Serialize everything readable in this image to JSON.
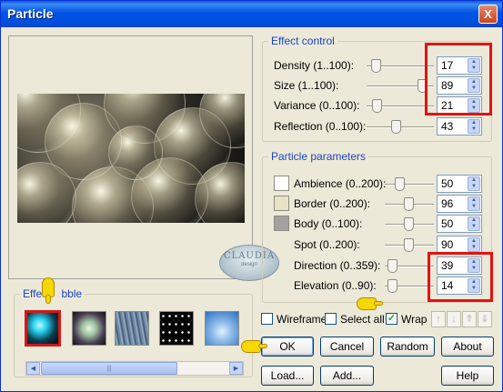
{
  "window": {
    "title": "Particle",
    "close_glyph": "X"
  },
  "logo": {
    "line1": "CLAUDIA",
    "line2": "design"
  },
  "effect_control": {
    "title": "Effect control",
    "rows": [
      {
        "label": "Density (1..100):",
        "value": "17"
      },
      {
        "label": "Size (1..100):",
        "value": "89"
      },
      {
        "label": "Variance (0..100):",
        "value": "21"
      },
      {
        "label": "Reflection (0..100):",
        "value": "43"
      }
    ]
  },
  "particle_params": {
    "title": "Particle parameters",
    "rows": [
      {
        "label": "Ambience (0..200):",
        "value": "50",
        "swatch": "#ffffff"
      },
      {
        "label": "Border (0..200):",
        "value": "96",
        "swatch": "#e7e3c4"
      },
      {
        "label": "Body (0..100):",
        "value": "50",
        "swatch": "#a3a29f"
      },
      {
        "label": "Spot (0..200):",
        "value": "90"
      },
      {
        "label": "Direction (0..359):",
        "value": "39"
      },
      {
        "label": "Elevation (0..90):",
        "value": "14"
      }
    ]
  },
  "effect_bubble": {
    "title_left": "Effect",
    "title_right": "bble"
  },
  "options": {
    "wireframe": "Wireframe",
    "select_all": "Select all",
    "wrap": "Wrap",
    "wrap_checked": "✓"
  },
  "buttons": {
    "ok": "OK",
    "cancel": "Cancel",
    "random": "Random",
    "about": "About",
    "load": "Load...",
    "add": "Add...",
    "help": "Help"
  },
  "scroll": {
    "left": "◀",
    "right": "▶",
    "grip": "|||"
  },
  "spin": {
    "up": "▲",
    "down": "▼"
  },
  "arrows": {
    "up": "↑",
    "down": "↓",
    "top": "⇑",
    "bottom": "⇓"
  },
  "colors": {
    "title_bar": "#0054e3",
    "highlight": "#e81010",
    "group_label": "#1d45c5",
    "face": "#ece9d8"
  }
}
